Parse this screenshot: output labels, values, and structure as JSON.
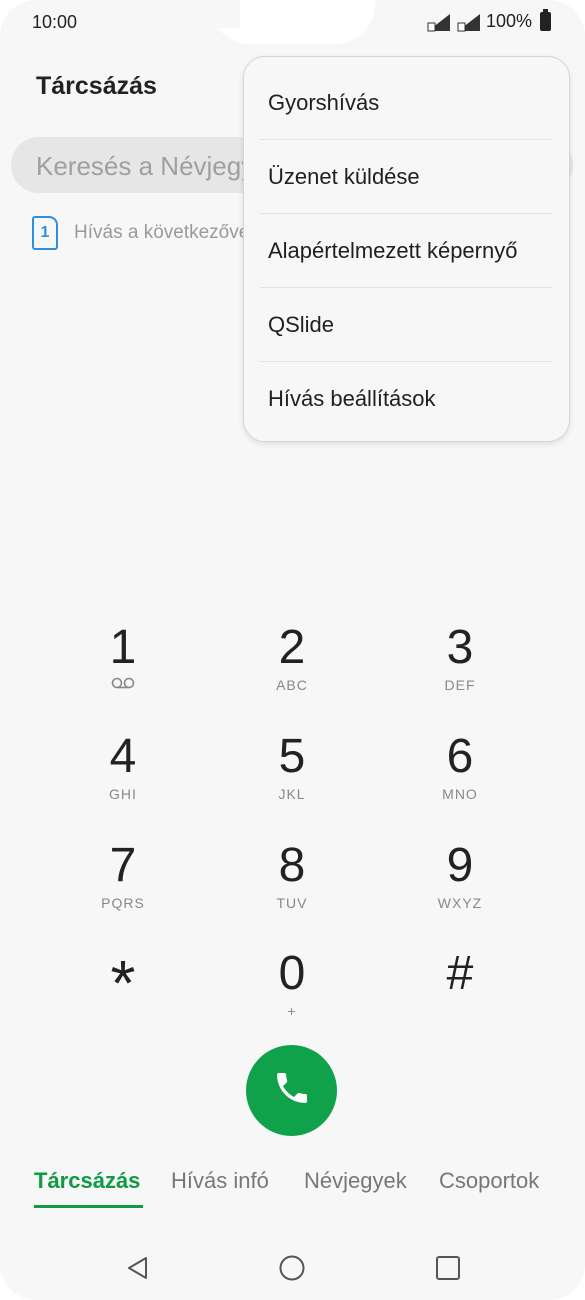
{
  "status_bar": {
    "time": "10:00",
    "battery": "100%"
  },
  "app": {
    "title": "Tárcsázás"
  },
  "search": {
    "placeholder": "Keresés a Névjegyekben"
  },
  "sim": {
    "number": "1",
    "text": "Hívás a következővel"
  },
  "menu": {
    "items": [
      {
        "label": "Gyorshívás"
      },
      {
        "label": "Üzenet küldése"
      },
      {
        "label": "Alapértelmezett képernyő"
      },
      {
        "label": "QSlide"
      },
      {
        "label": "Hívás beállítások"
      }
    ]
  },
  "dialpad": {
    "keys": [
      {
        "digit": "1",
        "sub": "voicemail-icon"
      },
      {
        "digit": "2",
        "sub": "ABC"
      },
      {
        "digit": "3",
        "sub": "DEF"
      },
      {
        "digit": "4",
        "sub": "GHI"
      },
      {
        "digit": "5",
        "sub": "JKL"
      },
      {
        "digit": "6",
        "sub": "MNO"
      },
      {
        "digit": "7",
        "sub": "PQRS"
      },
      {
        "digit": "8",
        "sub": "TUV"
      },
      {
        "digit": "9",
        "sub": "WXYZ"
      },
      {
        "digit": "*",
        "sub": ""
      },
      {
        "digit": "0",
        "sub": "+"
      },
      {
        "digit": "#",
        "sub": ""
      }
    ]
  },
  "call_button": {
    "icon": "phone-icon",
    "color": "#10a24a"
  },
  "tabs": [
    {
      "label": "Tárcsázás"
    },
    {
      "label": "Hívás infó"
    },
    {
      "label": "Névjegyek"
    },
    {
      "label": "Csoportok"
    }
  ],
  "colors": {
    "accent": "#0f9a44",
    "sim": "#2d8fe0"
  }
}
